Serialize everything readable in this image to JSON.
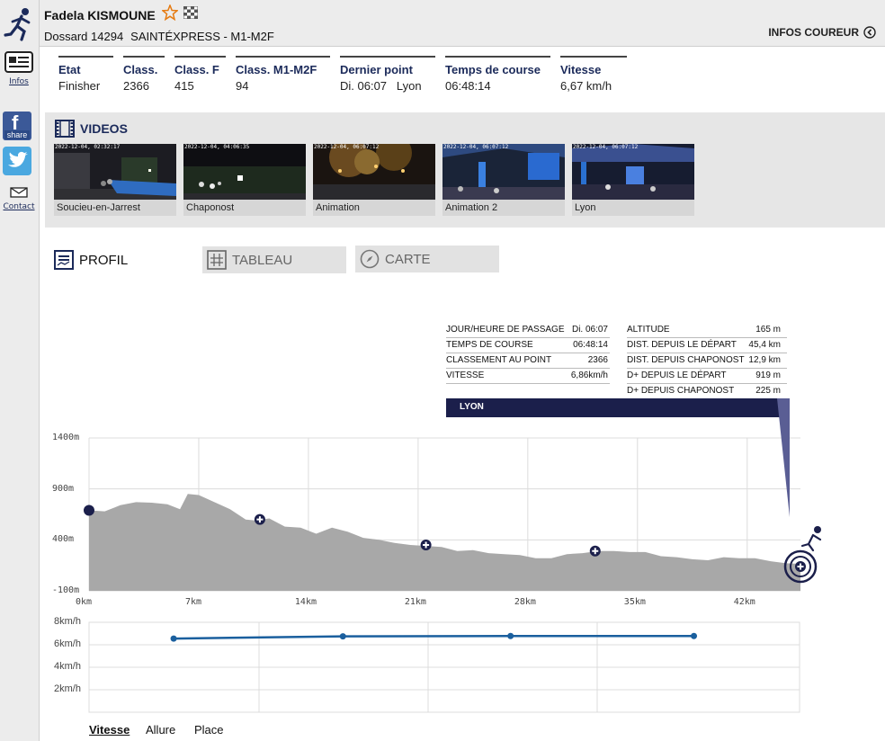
{
  "sidebar": {
    "infos_label": "Infos",
    "share_label": "share",
    "contact_label": "Contact"
  },
  "header": {
    "runner_name": "Fadela KISMOUNE",
    "dossard": "Dossard 14294",
    "race": "SAINTÉXPRESS - M1-M2F",
    "infos_coureur": "INFOS COUREUR"
  },
  "stats": [
    {
      "label": "Etat",
      "value": "Finisher"
    },
    {
      "label": "Class.",
      "value": "2366"
    },
    {
      "label": "Class. F",
      "value": "415"
    },
    {
      "label": "Class. M1-M2F",
      "value": "94"
    },
    {
      "label": "Dernier point",
      "value": "Di. 06:07   Lyon"
    },
    {
      "label": "Temps de course",
      "value": "06:48:14"
    },
    {
      "label": "Vitesse",
      "value": "6,67 km/h"
    }
  ],
  "videos": {
    "title": "VIDEOS",
    "items": [
      {
        "caption": "Soucieu-en-Jarrest",
        "timestamp": "2022-12-04, 02:32:17"
      },
      {
        "caption": "Chaponost",
        "timestamp": "2022-12-04, 04:06:35"
      },
      {
        "caption": "Animation",
        "timestamp": "2022-12-04, 06:07:12"
      },
      {
        "caption": "Animation 2",
        "timestamp": "2022-12-04, 06:07:12"
      },
      {
        "caption": "Lyon",
        "timestamp": "2022-12-04, 06:07:12"
      }
    ]
  },
  "tabs": {
    "profil": "PROFIL",
    "tableau": "TABLEAU",
    "carte": "CARTE"
  },
  "info_panel": {
    "left": [
      {
        "label": "JOUR/HEURE DE PASSAGE",
        "value": "Di. 06:07"
      },
      {
        "label": "TEMPS DE COURSE",
        "value": "06:48:14"
      },
      {
        "label": "CLASSEMENT AU POINT",
        "value": "2366"
      },
      {
        "label": "VITESSE",
        "value": "6,86km/h"
      }
    ],
    "right": [
      {
        "label": "ALTITUDE",
        "value": "165 m"
      },
      {
        "label": "DIST. DEPUIS LE DÉPART",
        "value": "45,4 km"
      },
      {
        "label": "DIST. DEPUIS CHAPONOST",
        "value": "12,9 km"
      },
      {
        "label": "D+ DEPUIS LE DÉPART",
        "value": "919 m"
      },
      {
        "label": "D+ DEPUIS CHAPONOST",
        "value": "225 m"
      }
    ],
    "point_name": "LYON"
  },
  "chart_data": [
    {
      "type": "area",
      "y_tick_labels": [
        "1400m",
        "900m",
        "400m",
        "-100m"
      ],
      "x_tick_labels": [
        "0km",
        "7km",
        "14km",
        "21km",
        "28km",
        "35km",
        "42km"
      ],
      "x_ticks": [
        0,
        7,
        14,
        21,
        28,
        35,
        42
      ],
      "ylim": [
        -100,
        1400
      ],
      "xlim": [
        0,
        45.4
      ],
      "grid": true,
      "x": [
        0,
        1,
        2,
        3,
        4,
        5,
        5.8,
        6.3,
        7,
        8,
        9,
        10,
        10.6,
        11.5,
        12.5,
        13.5,
        14.5,
        15.5,
        16.5,
        17.5,
        18.5,
        19.5,
        20.5,
        21.5,
        22.5,
        23.5,
        24.5,
        25.5,
        26.5,
        27.5,
        28.5,
        29.5,
        30.5,
        31.5,
        32.5,
        33.5,
        34.5,
        35.5,
        36.5,
        37.5,
        38.5,
        39.5,
        40.5,
        41.5,
        42.5,
        43.5,
        44.5,
        45.4
      ],
      "y": [
        690,
        680,
        740,
        770,
        765,
        750,
        700,
        850,
        840,
        770,
        700,
        600,
        590,
        610,
        530,
        520,
        460,
        520,
        480,
        420,
        400,
        370,
        350,
        340,
        330,
        290,
        300,
        270,
        260,
        250,
        220,
        220,
        260,
        270,
        290,
        290,
        280,
        280,
        240,
        230,
        210,
        200,
        230,
        220,
        220,
        190,
        170,
        165
      ],
      "checkpoints": [
        {
          "name": "start",
          "x": 0,
          "y": 690
        },
        {
          "x": 10.9,
          "y": 600
        },
        {
          "x": 21.5,
          "y": 350
        },
        {
          "x": 32.3,
          "y": 290
        },
        {
          "name": "Lyon",
          "x": 45.4,
          "y": 165
        }
      ]
    },
    {
      "type": "line",
      "y_tick_labels": [
        "8km/h",
        "6km/h",
        "4km/h",
        "2km/h"
      ],
      "ylim": [
        0,
        8
      ],
      "grid": true,
      "x": [
        5.4,
        16.2,
        26.9,
        38.6
      ],
      "y": [
        6.55,
        6.75,
        6.78,
        6.78
      ]
    }
  ],
  "bottom_tabs": [
    "Vitesse",
    "Allure",
    "Place"
  ],
  "colors": {
    "navy": "#1b2a5a",
    "profile_fill": "#a8a8a8",
    "speed_line": "#1a5f9e",
    "lyon_bar": "#1b1f4b"
  }
}
